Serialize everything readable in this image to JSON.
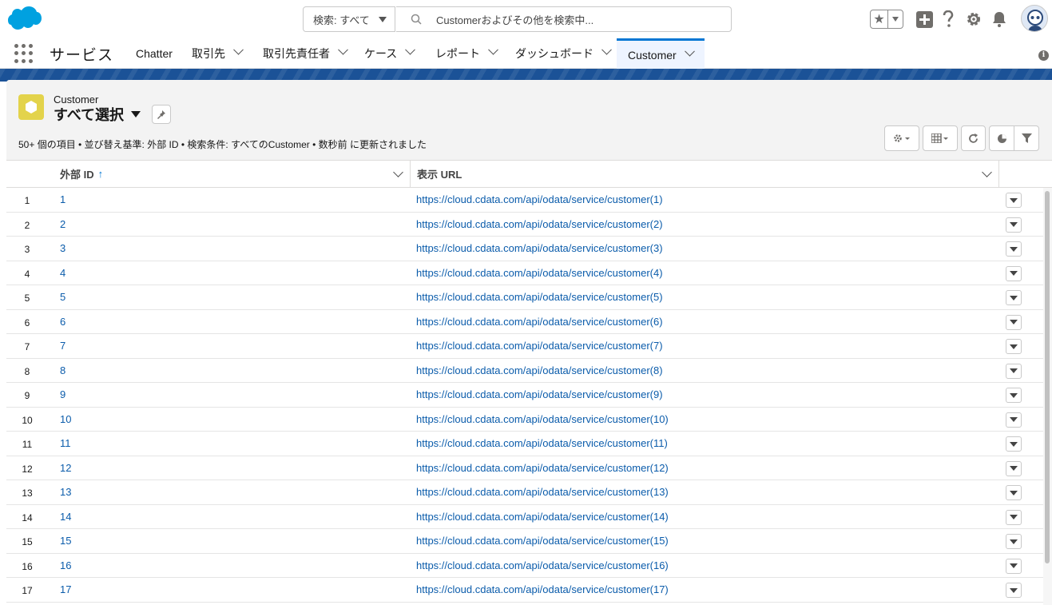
{
  "header": {
    "search_scope": "検索: すべて",
    "search_placeholder": "Customerおよびその他を検索中..."
  },
  "nav": {
    "app_name": "サービス",
    "items": [
      {
        "label": "Chatter",
        "has_menu": false
      },
      {
        "label": "取引先",
        "has_menu": true
      },
      {
        "label": "取引先責任者",
        "has_menu": true
      },
      {
        "label": "ケース",
        "has_menu": true
      },
      {
        "label": "レポート",
        "has_menu": true
      },
      {
        "label": "ダッシュボード",
        "has_menu": true
      },
      {
        "label": "Customer",
        "has_menu": true,
        "active": true
      }
    ]
  },
  "list": {
    "object_label": "Customer",
    "view_name": "すべて選択",
    "meta": "50+ 個の項目 • 並び替え基準: 外部 ID • 検索条件: すべてのCustomer • 数秒前 に更新されました",
    "columns": [
      {
        "label": "外部 ID",
        "sort": "↑"
      },
      {
        "label": "表示 URL"
      }
    ],
    "rows": [
      {
        "num": "1",
        "ext_id": "1",
        "url": "https://cloud.cdata.com/api/odata/service/customer(1)"
      },
      {
        "num": "2",
        "ext_id": "2",
        "url": "https://cloud.cdata.com/api/odata/service/customer(2)"
      },
      {
        "num": "3",
        "ext_id": "3",
        "url": "https://cloud.cdata.com/api/odata/service/customer(3)"
      },
      {
        "num": "4",
        "ext_id": "4",
        "url": "https://cloud.cdata.com/api/odata/service/customer(4)"
      },
      {
        "num": "5",
        "ext_id": "5",
        "url": "https://cloud.cdata.com/api/odata/service/customer(5)"
      },
      {
        "num": "6",
        "ext_id": "6",
        "url": "https://cloud.cdata.com/api/odata/service/customer(6)"
      },
      {
        "num": "7",
        "ext_id": "7",
        "url": "https://cloud.cdata.com/api/odata/service/customer(7)"
      },
      {
        "num": "8",
        "ext_id": "8",
        "url": "https://cloud.cdata.com/api/odata/service/customer(8)"
      },
      {
        "num": "9",
        "ext_id": "9",
        "url": "https://cloud.cdata.com/api/odata/service/customer(9)"
      },
      {
        "num": "10",
        "ext_id": "10",
        "url": "https://cloud.cdata.com/api/odata/service/customer(10)"
      },
      {
        "num": "11",
        "ext_id": "11",
        "url": "https://cloud.cdata.com/api/odata/service/customer(11)"
      },
      {
        "num": "12",
        "ext_id": "12",
        "url": "https://cloud.cdata.com/api/odata/service/customer(12)"
      },
      {
        "num": "13",
        "ext_id": "13",
        "url": "https://cloud.cdata.com/api/odata/service/customer(13)"
      },
      {
        "num": "14",
        "ext_id": "14",
        "url": "https://cloud.cdata.com/api/odata/service/customer(14)"
      },
      {
        "num": "15",
        "ext_id": "15",
        "url": "https://cloud.cdata.com/api/odata/service/customer(15)"
      },
      {
        "num": "16",
        "ext_id": "16",
        "url": "https://cloud.cdata.com/api/odata/service/customer(16)"
      },
      {
        "num": "17",
        "ext_id": "17",
        "url": "https://cloud.cdata.com/api/odata/service/customer(17)"
      }
    ]
  },
  "icons": {
    "logo": "salesforce-cloud-icon",
    "search": "search-icon",
    "favorites": "star-icon",
    "global_actions": "plus-icon",
    "help": "question-icon",
    "setup": "gear-icon",
    "notifications": "bell-icon",
    "app_launcher": "waffle-icon",
    "object": "hexagon-icon",
    "pin": "pin-icon"
  },
  "colors": {
    "brand": "#0176d3",
    "link": "#0b5cab",
    "band": "#1b5297",
    "object_icon": "#e3d34b"
  }
}
